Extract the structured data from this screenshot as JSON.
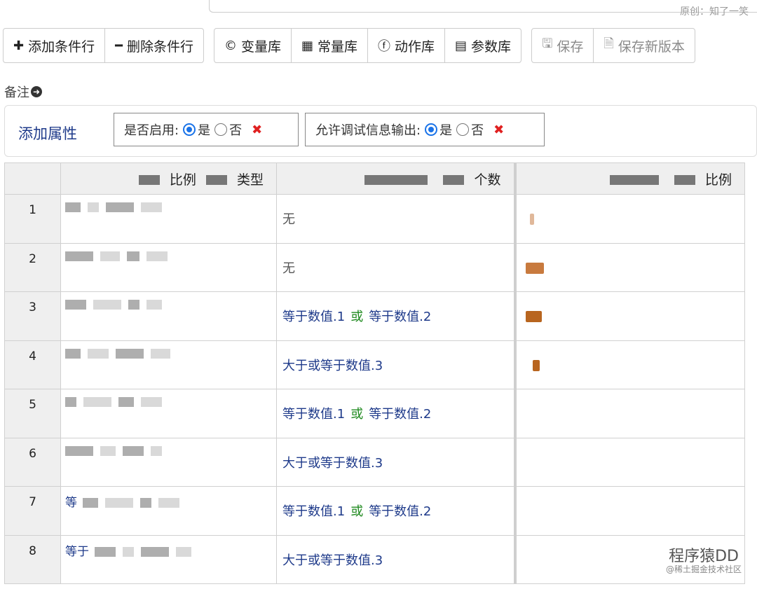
{
  "watermark_top": "原创：知了一笑",
  "toolbar": {
    "group1": [
      {
        "icon": "plus-icon",
        "glyph": "✚",
        "label": "添加条件行"
      },
      {
        "icon": "minus-icon",
        "glyph": "━",
        "label": "删除条件行"
      }
    ],
    "group2": [
      {
        "icon": "copyright-icon",
        "glyph": "©",
        "label": "变量库"
      },
      {
        "icon": "grid-icon",
        "glyph": "▦",
        "label": "常量库"
      },
      {
        "icon": "bolt-icon",
        "glyph": "ⓕ",
        "label": "动作库"
      },
      {
        "icon": "list-icon",
        "glyph": "▤",
        "label": "参数库"
      }
    ],
    "group3": [
      {
        "icon": "save-icon",
        "glyph": "🖫",
        "label": "保存"
      },
      {
        "icon": "save-version-icon",
        "glyph": "🗎",
        "label": "保存新版本"
      }
    ]
  },
  "remark_label": "备注",
  "attributes": {
    "title": "添加属性",
    "enable": {
      "label": "是否启用:",
      "yes": "是",
      "no": "否",
      "selected": "是"
    },
    "debug": {
      "label": "允许调试信息输出:",
      "yes": "是",
      "no": "否",
      "selected": "是"
    }
  },
  "table": {
    "headers": [
      "",
      "比例",
      "类型",
      "个数",
      "比例"
    ],
    "rows": [
      {
        "idx": "1",
        "cond_type": "none",
        "cond": "无",
        "bar": {
          "color": "#e0b89a",
          "from": 0.06,
          "to": 0.07
        }
      },
      {
        "idx": "2",
        "cond_type": "none",
        "cond": "无",
        "bar": {
          "color": "#c87a3e",
          "from": 0.04,
          "to": 0.12
        }
      },
      {
        "idx": "3",
        "cond_type": "or",
        "cond_a": "等于数值.1",
        "or": "或",
        "cond_b": "等于数值.2",
        "bar": {
          "color": "#b8651f",
          "from": 0.04,
          "to": 0.11
        }
      },
      {
        "idx": "4",
        "cond_type": "single",
        "cond": "大于或等于数值.3",
        "bar": {
          "color": "#b8651f",
          "from": 0.07,
          "to": 0.1
        }
      },
      {
        "idx": "5",
        "cond_type": "or",
        "cond_a": "等于数值.1",
        "or": "或",
        "cond_b": "等于数值.2"
      },
      {
        "idx": "6",
        "cond_type": "single",
        "cond": "大于或等于数值.3"
      },
      {
        "idx": "7",
        "cond_type": "or",
        "cond_a": "等于数值.1",
        "or": "或",
        "cond_b": "等于数值.2"
      },
      {
        "idx": "8",
        "cond_type": "single",
        "cond": "大于或等于数值.3"
      }
    ],
    "col1_prefix": {
      "7": "等",
      "8": "等于"
    }
  },
  "footer": {
    "mark": "程序猿DD",
    "sub": "@稀土掘金技术社区"
  }
}
